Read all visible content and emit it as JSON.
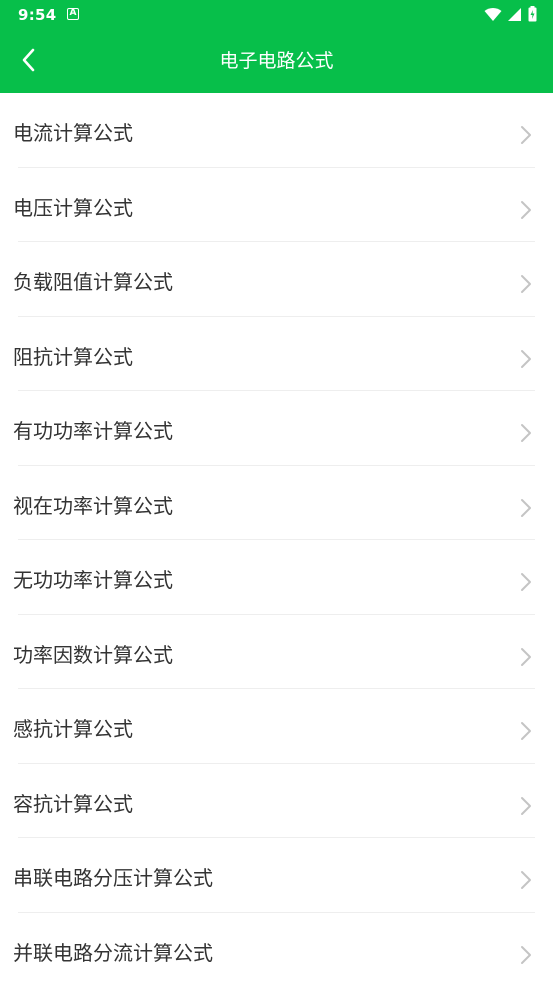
{
  "status_bar": {
    "time": "9:54",
    "notification_icon": "A",
    "icons": [
      "wifi-icon",
      "signal-icon",
      "battery-icon"
    ]
  },
  "app_bar": {
    "title": "电子电路公式",
    "back_icon": "chevron-left-icon"
  },
  "colors": {
    "primary": "#07bf4a",
    "text": "#333333",
    "chevron": "#c4c4c4",
    "divider": "#eeeeee"
  },
  "items": [
    {
      "label": "电流计算公式"
    },
    {
      "label": "电压计算公式"
    },
    {
      "label": "负载阻值计算公式"
    },
    {
      "label": "阻抗计算公式"
    },
    {
      "label": "有功功率计算公式"
    },
    {
      "label": "视在功率计算公式"
    },
    {
      "label": "无功功率计算公式"
    },
    {
      "label": "功率因数计算公式"
    },
    {
      "label": "感抗计算公式"
    },
    {
      "label": "容抗计算公式"
    },
    {
      "label": "串联电路分压计算公式"
    },
    {
      "label": "并联电路分流计算公式"
    }
  ]
}
